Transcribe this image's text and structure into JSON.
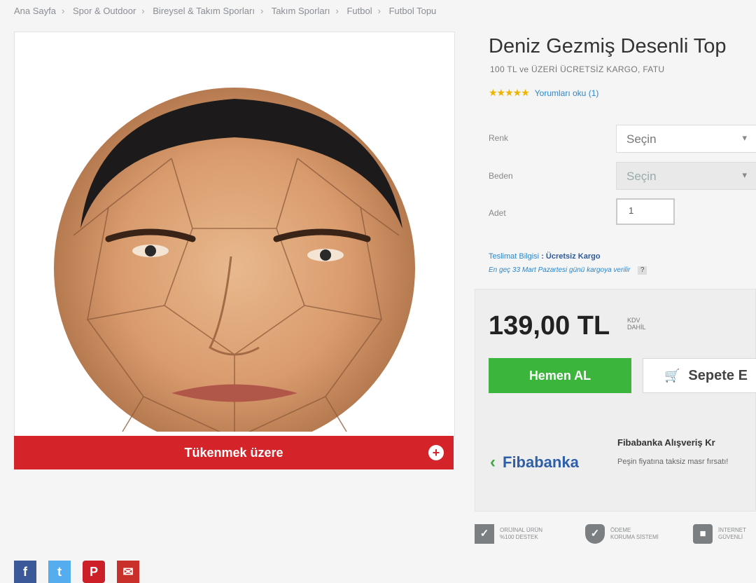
{
  "breadcrumb": [
    "Ana Sayfa",
    "Spor & Outdoor",
    "Bireysel & Takım Sporları",
    "Takım Sporları",
    "Futbol",
    "Futbol Topu"
  ],
  "product": {
    "title": "Deniz Gezmiş Desenli Top",
    "shipping_note": "100 TL ve ÜZERİ ÜCRETSİZ KARGO, FATU",
    "rating_stars": 5,
    "review_link": "Yorumları oku (1)"
  },
  "stock_banner": "Tükenmek üzere",
  "options": {
    "renk_label": "Renk",
    "renk_value": "Seçin",
    "beden_label": "Beden",
    "beden_value": "Seçin",
    "adet_label": "Adet",
    "adet_value": "1"
  },
  "delivery": {
    "label": "Teslimat Bilgisi",
    "value": ": Ücretsiz Kargo",
    "note": "En geç 33 Mart Pazartesi günü kargoya verilir"
  },
  "price": {
    "amount": "139,00 TL",
    "kdv_line1": "KDV",
    "kdv_line2": "DAHİL"
  },
  "buttons": {
    "buy_now": "Hemen AL",
    "add_to_cart": "Sepete E"
  },
  "bank": {
    "logo_text": "Fibabanka",
    "title": "Fibabanka Alışveriş Kr",
    "desc": "Peşin fiyatına taksiz masr fırsatı!"
  },
  "badges": [
    {
      "icon": "original-product-icon",
      "line1": "ORİJİNAL ÜRÜN",
      "line2": "%100 DESTEK"
    },
    {
      "icon": "shield-icon",
      "line1": "ÖDEME",
      "line2": "KORUMA SİSTEMİ"
    },
    {
      "icon": "lock-icon",
      "line1": "İNTERNET",
      "line2": "GÜVENLİ"
    }
  ],
  "colors": {
    "stock_red": "#d5232a",
    "buy_green": "#3cb53c",
    "link_blue": "#2c86c9",
    "fiba_blue": "#2f5fa6"
  }
}
